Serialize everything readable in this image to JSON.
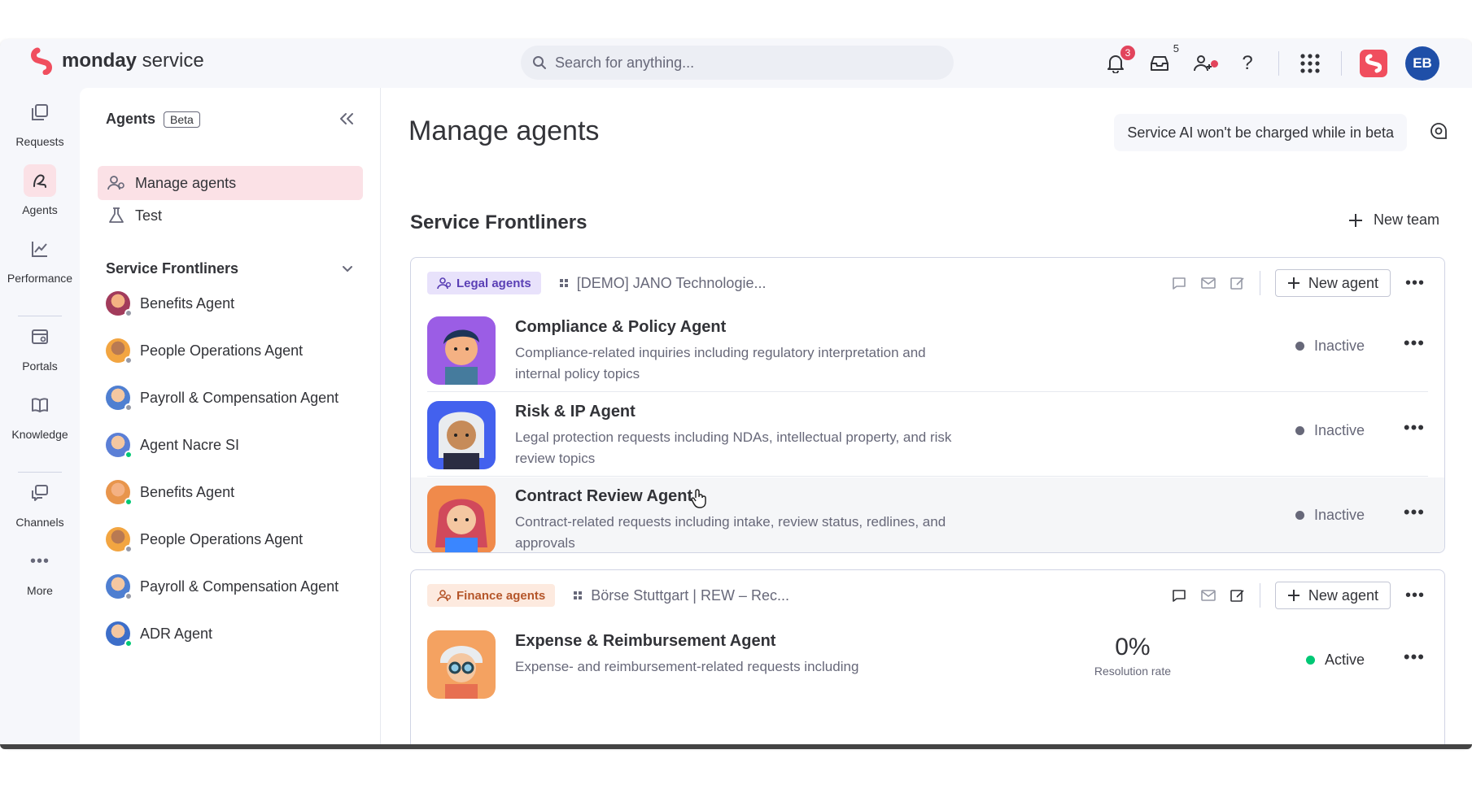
{
  "app": {
    "brand_bold": "monday",
    "brand_light": " service",
    "search_placeholder": "Search for anything...",
    "notifications_count": "3",
    "inbox_count": "5",
    "avatar_initials": "EB",
    "accent": "#f04e5e",
    "avatar_color": "#1f4fa8"
  },
  "rail": {
    "items": [
      {
        "label": "Requests",
        "icon": "requests-icon"
      },
      {
        "label": "Agents",
        "icon": "agent-icon"
      },
      {
        "label": "Performance",
        "icon": "chart-icon"
      },
      {
        "label": "Portals",
        "icon": "portal-icon"
      },
      {
        "label": "Knowledge",
        "icon": "book-icon"
      },
      {
        "label": "Channels",
        "icon": "channels-icon"
      },
      {
        "label": "More",
        "icon": "more-icon"
      }
    ]
  },
  "sidebar": {
    "title": "Agents",
    "badge": "Beta",
    "links": [
      {
        "label": "Manage agents",
        "icon": "manage-agents-icon"
      },
      {
        "label": "Test",
        "icon": "flask-icon"
      }
    ],
    "group": "Service Frontliners",
    "agents": [
      {
        "name": "Benefits Agent",
        "online": false
      },
      {
        "name": "People Operations Agent",
        "online": false
      },
      {
        "name": "Payroll & Compensation Agent",
        "online": false
      },
      {
        "name": "Agent Nacre SI",
        "online": true
      },
      {
        "name": "Benefits Agent",
        "online": true
      },
      {
        "name": "People Operations Agent",
        "online": false
      },
      {
        "name": "Payroll & Compensation Agent",
        "online": false
      },
      {
        "name": "ADR Agent",
        "online": true
      }
    ]
  },
  "main": {
    "title": "Manage agents",
    "beta_note": "Service AI won't be charged while in beta",
    "team_title": "Service Frontliners",
    "new_team_label": "New team",
    "teams": [
      {
        "tag": "Legal agents",
        "board": "[DEMO] JANO Technologie...",
        "new_agent_label": "New agent",
        "agents": [
          {
            "name": "Compliance & Policy Agent",
            "desc": "Compliance-related inquiries including regulatory interpretation and internal policy topics",
            "status": "Inactive"
          },
          {
            "name": "Risk & IP Agent",
            "desc": "Legal protection requests including NDAs, intellectual property, and risk review topics",
            "status": "Inactive"
          },
          {
            "name": "Contract Review Agent",
            "desc": "Contract-related requests including intake, review status, redlines, and approvals",
            "status": "Inactive"
          }
        ]
      },
      {
        "tag": "Finance agents",
        "board": "Börse Stuttgart | REW – Rec...",
        "new_agent_label": "New agent",
        "agents": [
          {
            "name": "Expense & Reimbursement Agent",
            "desc": "Expense- and reimbursement-related requests including",
            "status": "Active",
            "metric_value": "0%",
            "metric_label": "Resolution rate"
          }
        ]
      }
    ]
  }
}
